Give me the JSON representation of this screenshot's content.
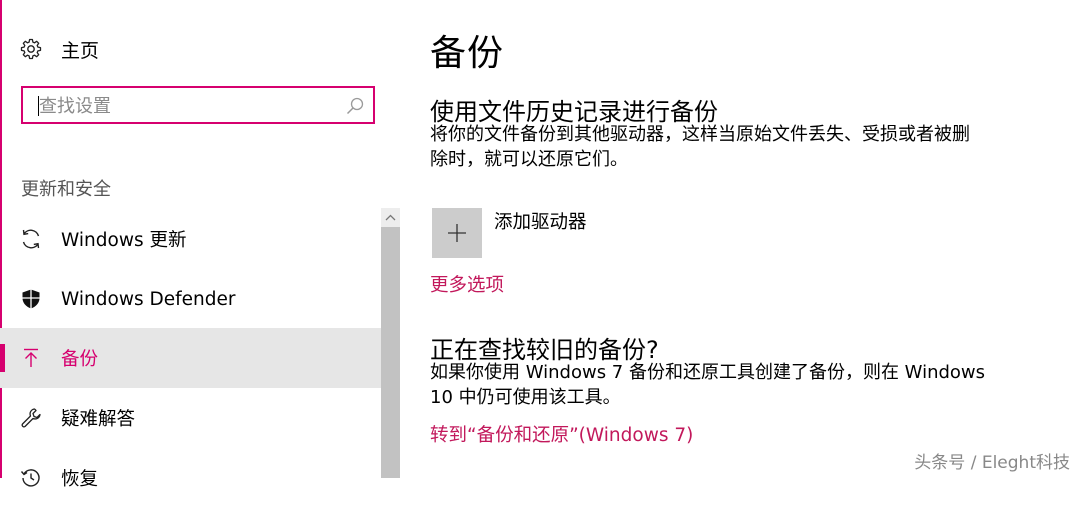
{
  "sidebar": {
    "home_label": "主页",
    "search": {
      "placeholder": "查找设置"
    },
    "section_title": "更新和安全",
    "items": [
      {
        "label": "Windows 更新",
        "icon": "sync-icon"
      },
      {
        "label": "Windows Defender",
        "icon": "shield-icon"
      },
      {
        "label": "备份",
        "icon": "upload-arrow-icon",
        "selected": true
      },
      {
        "label": "疑难解答",
        "icon": "wrench-icon"
      },
      {
        "label": "恢复",
        "icon": "history-icon"
      }
    ]
  },
  "main": {
    "page_title": "备份",
    "file_history": {
      "heading": "使用文件历史记录进行备份",
      "description": "将你的文件备份到其他驱动器，这样当原始文件丢失、受损或者被删除时，就可以还原它们。",
      "add_drive_label": "添加驱动器",
      "more_options_link": "更多选项"
    },
    "older_backup": {
      "heading": "正在查找较旧的备份?",
      "description": "如果你使用 Windows 7 备份和还原工具创建了备份，则在 Windows 10 中仍可使用该工具。",
      "link": "转到“备份和还原”(Windows 7)"
    }
  },
  "watermark": "头条号 / Eleght科技",
  "colors": {
    "accent": "#d6006f",
    "link": "#c2185b",
    "selected_bg": "#e6e6e6"
  }
}
